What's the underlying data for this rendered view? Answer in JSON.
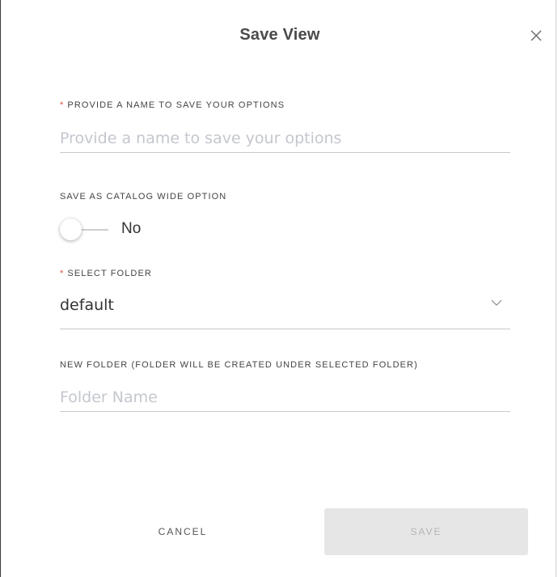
{
  "dialog": {
    "title": "Save View",
    "close_icon": "close-icon"
  },
  "name_field": {
    "required_mark": "*",
    "label": "PROVIDE A NAME TO SAVE YOUR OPTIONS",
    "value": "",
    "placeholder": "Provide a name to save your options"
  },
  "catalog_option": {
    "label": "SAVE AS CATALOG WIDE OPTION",
    "toggle_text": "No",
    "enabled": false
  },
  "folder_select": {
    "required_mark": "*",
    "label": "SELECT FOLDER",
    "selected": "default",
    "icon": "chevron-down-icon"
  },
  "new_folder": {
    "label": "NEW FOLDER (FOLDER WILL BE CREATED UNDER SELECTED FOLDER)",
    "value": "",
    "placeholder": "Folder Name"
  },
  "actions": {
    "cancel_label": "CANCEL",
    "save_label": "SAVE"
  },
  "colors": {
    "required": "#e04b3a",
    "save_disabled_bg": "#e6e6e6",
    "save_disabled_text": "#b5b5b5"
  }
}
